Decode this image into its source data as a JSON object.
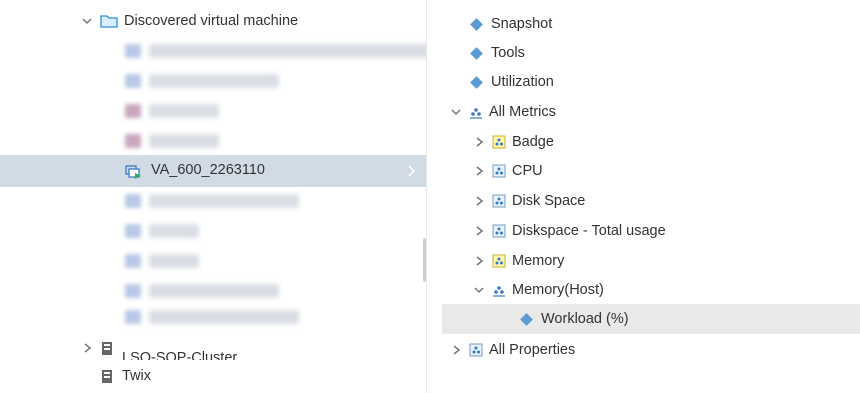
{
  "left_tree": {
    "discovered_folder": "Discovered virtual machine",
    "selected_vm": "VA_600_2263110",
    "cluster_partial": "LSO-SOP-Cluster",
    "twix": "Twix"
  },
  "right_tree": {
    "snapshot": "Snapshot",
    "tools": "Tools",
    "utilization": "Utilization",
    "all_metrics": "All Metrics",
    "badge": "Badge",
    "cpu": "CPU",
    "disk_space": "Disk Space",
    "diskspace_total": "Diskspace - Total usage",
    "memory": "Memory",
    "memory_host": "Memory(Host)",
    "workload": "Workload (%)",
    "all_properties": "All Properties"
  },
  "colors": {
    "selected_row": "#d1dbe5",
    "hover_row": "#e9e9e9",
    "diamond": "#5b9bd5",
    "folder": "#2f8fd8",
    "vm_icon": "#3a7bbf"
  }
}
